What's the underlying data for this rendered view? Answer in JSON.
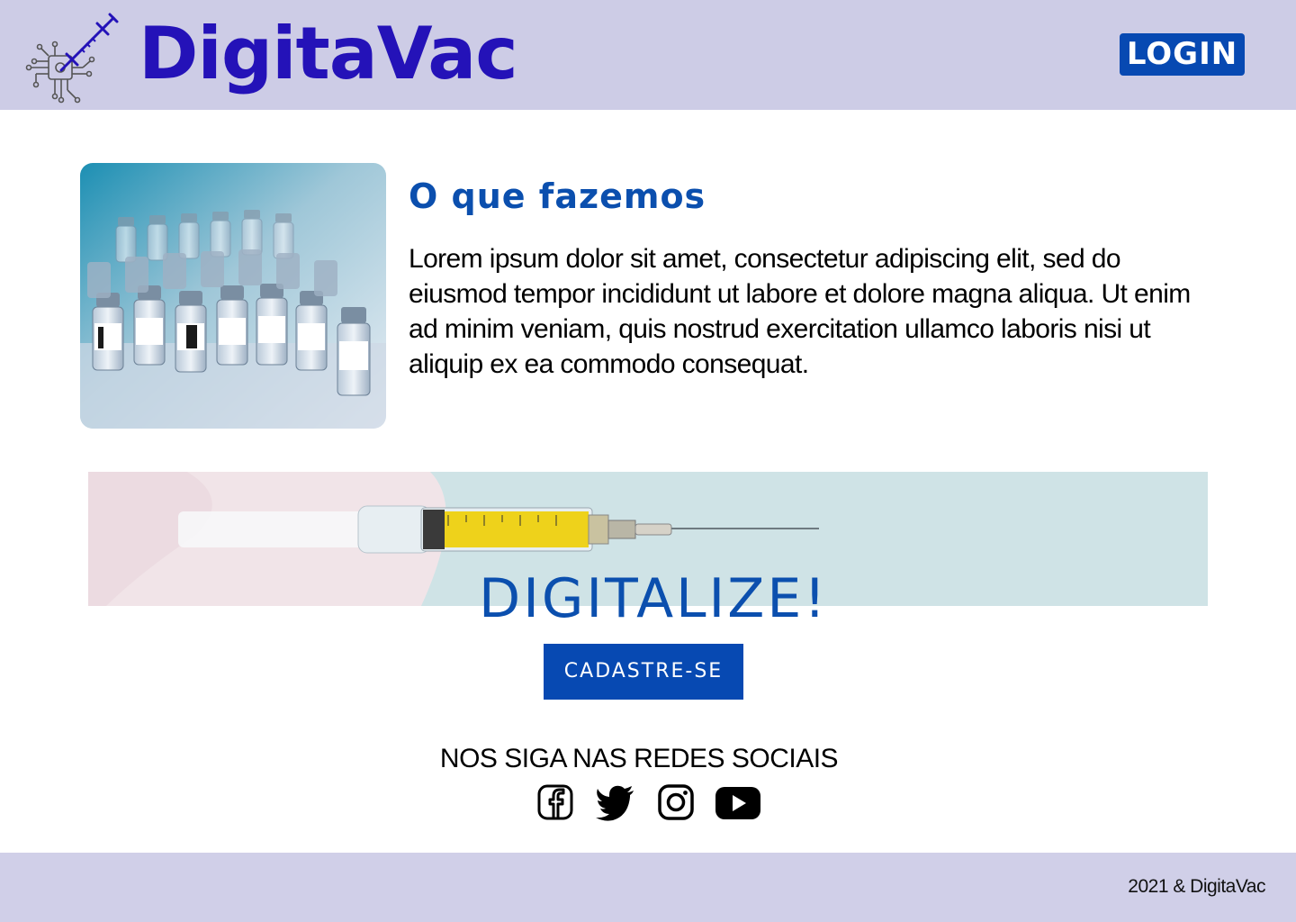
{
  "header": {
    "brand": "DigitaVac",
    "logo_icon": "syringe-chip-icon",
    "login_label": "LOGIN"
  },
  "about": {
    "title": "O que fazemos",
    "text": "Lorem ipsum dolor sit amet, consectetur adipiscing elit, sed do eiusmod tempor incididunt ut labore et dolore magna aliqua. Ut enim ad minim veniam, quis nostrud exercitation ullamco laboris nisi ut aliquip ex ea commodo consequat.",
    "image": "vaccine-vials-image"
  },
  "cta": {
    "banner_image": "syringe-banner-image",
    "title": "DIGITALIZE!",
    "signup_label": "CADASTRE-SE"
  },
  "social": {
    "title": "NOS SIGA NAS REDES SOCIAIS",
    "icons": [
      "facebook-icon",
      "twitter-icon",
      "instagram-icon",
      "youtube-icon"
    ]
  },
  "footer": {
    "copyright": "2021 & DigitaVac"
  },
  "colors": {
    "header_bg": "#cdcce6",
    "brand": "#2412b8",
    "primary": "#0749b2",
    "heading": "#0b4fae",
    "footer_bg": "#d0cfe8"
  }
}
